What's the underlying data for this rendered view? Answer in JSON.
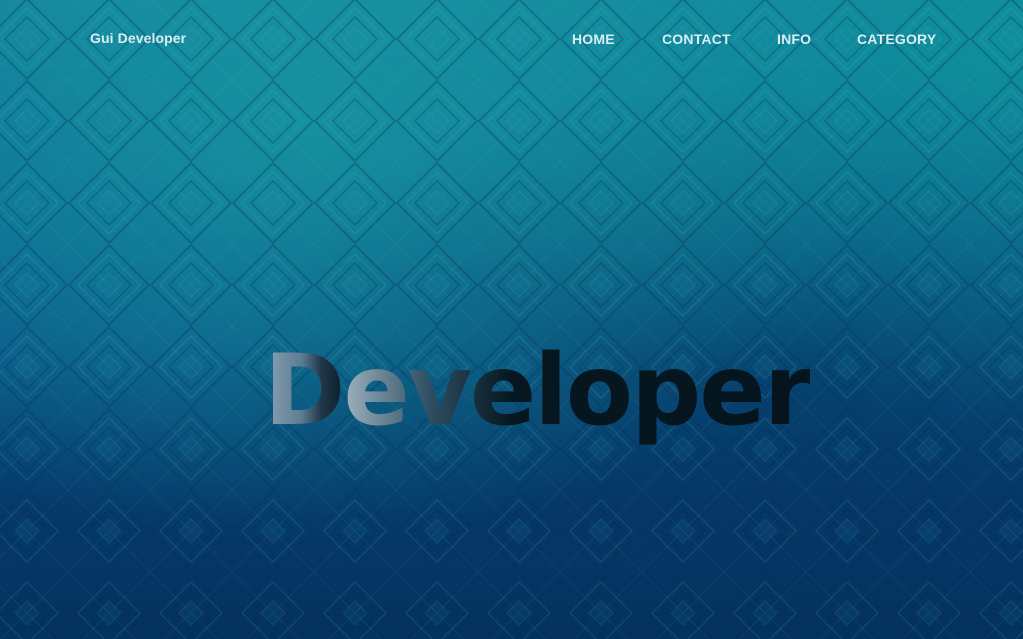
{
  "header": {
    "brand": "Gui Developer",
    "nav": [
      {
        "label": "HOME"
      },
      {
        "label": "CONTACT"
      },
      {
        "label": "INFO"
      },
      {
        "label": "CATEGORY"
      }
    ]
  },
  "hero": {
    "title_first": "D",
    "title_rest": "eveloper"
  },
  "colors": {
    "background_top": "#137f9d",
    "background_bottom": "#06386a",
    "nav_text": "#d9eef3",
    "hero_text": "#071926"
  }
}
